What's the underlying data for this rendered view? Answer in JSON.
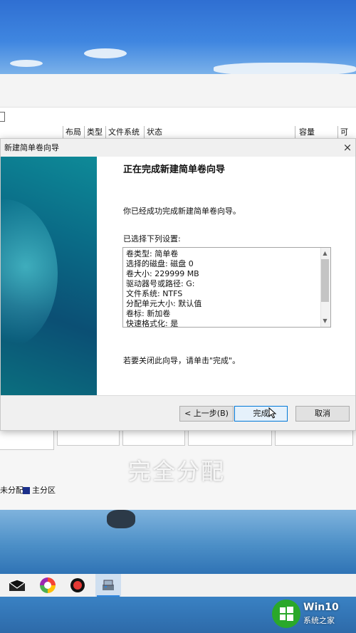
{
  "disk_mgmt": {
    "columns": [
      "布局",
      "类型",
      "文件系统",
      "状态",
      "容量",
      "可"
    ],
    "legend": {
      "unallocated": "未分配",
      "primary": "主分区"
    }
  },
  "overlay_caption": "完全分配",
  "wizard": {
    "title": "新建简单卷向导",
    "close_glyph": "×",
    "heading": "正在完成新建简单卷向导",
    "success_message": "你已经成功完成新建简单卷向导。",
    "selected_settings_label": "已选择下列设置:",
    "settings": [
      "卷类型: 简单卷",
      "选择的磁盘: 磁盘 0",
      "卷大小: 229999 MB",
      "驱动器号或路径: G:",
      "文件系统: NTFS",
      "分配单元大小: 默认值",
      "卷标: 新加卷",
      "快速格式化: 是"
    ],
    "close_hint": "若要关闭此向导，请单击\"完成\"。",
    "buttons": {
      "back": "< 上一步(B)",
      "finish": "完成",
      "cancel": "取消"
    }
  },
  "taskbar": {
    "icons": [
      "mail-icon",
      "photos-icon",
      "record-icon",
      "disk-management-icon"
    ]
  },
  "watermark": {
    "brand": "Win10",
    "subtitle": "系统之家"
  },
  "colors": {
    "primary_partition": "#1b2f8a",
    "finish_border": "#0078d7",
    "banner": "#0a6a86"
  }
}
